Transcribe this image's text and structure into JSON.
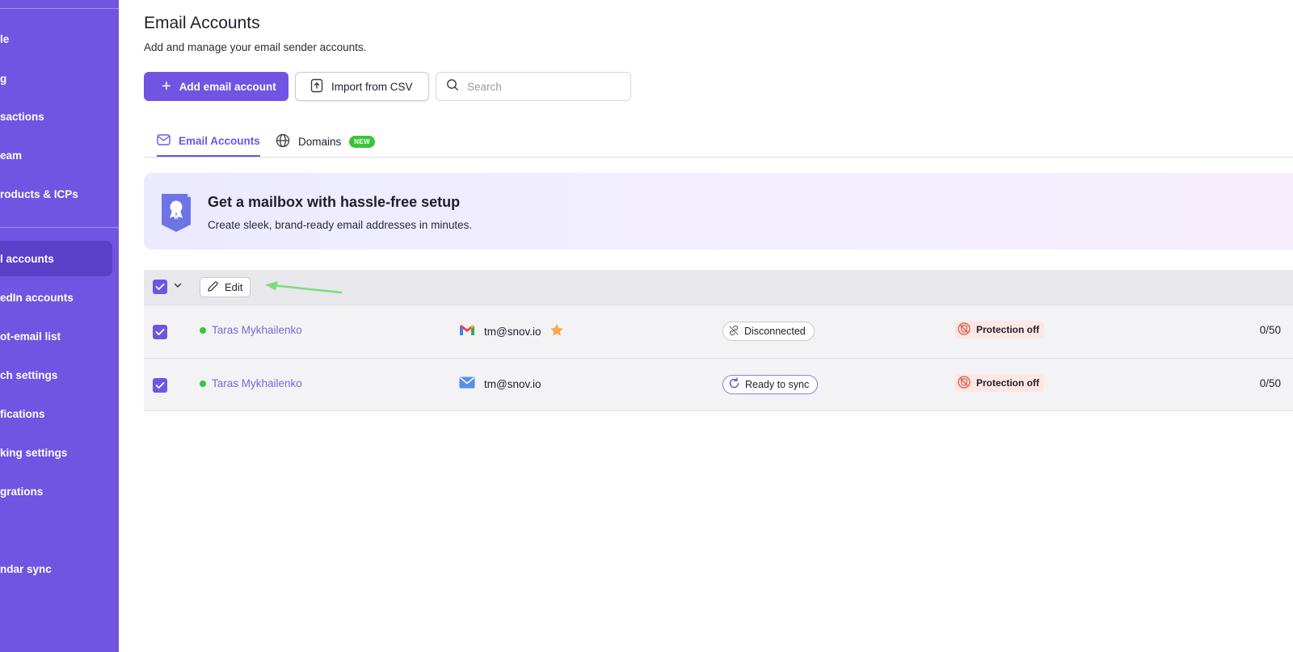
{
  "sidebar": {
    "items": [
      {
        "label": "le",
        "active": false
      },
      {
        "label": "g",
        "active": false
      },
      {
        "label": "sactions",
        "active": false
      },
      {
        "label": "eam",
        "active": false
      },
      {
        "label": "roducts & ICPs",
        "active": false
      },
      {
        "label": "l accounts",
        "active": true
      },
      {
        "label": "edIn accounts",
        "active": false
      },
      {
        "label": "ot-email list",
        "active": false
      },
      {
        "label": "ch settings",
        "active": false
      },
      {
        "label": "fications",
        "active": false
      },
      {
        "label": "king settings",
        "active": false
      },
      {
        "label": "grations",
        "active": false
      },
      {
        "label": "ndar sync",
        "active": false
      }
    ],
    "color": "#6f55e1"
  },
  "header": {
    "title": "Email Accounts",
    "subtitle": "Add and manage your email sender accounts."
  },
  "toolbar": {
    "add_label": "Add email account",
    "import_label": "Import from CSV",
    "search_placeholder": "Search"
  },
  "tabs": [
    {
      "label": "Email Accounts",
      "icon": "envelope-icon",
      "active": true
    },
    {
      "label": "Domains",
      "icon": "globe-icon",
      "badge": "NEW",
      "active": false
    }
  ],
  "banner": {
    "title": "Get a mailbox with hassle-free setup",
    "subtitle": "Create sleek, brand-ready email addresses in minutes."
  },
  "table": {
    "edit_label": "Edit",
    "rows": [
      {
        "name": "Taras Mykhailenko",
        "email": "tm@snov.io",
        "provider": "gmail-icon",
        "starred": true,
        "status": "Disconnected",
        "protection": "Protection off",
        "count": "0/50",
        "checked": true
      },
      {
        "name": "Taras Mykhailenko",
        "email": "tm@snov.io",
        "provider": "mail-icon",
        "starred": false,
        "status": "Ready to sync",
        "protection": "Protection off",
        "count": "0/50",
        "checked": true
      }
    ]
  },
  "colors": {
    "accent": "#6f55e1",
    "online": "#3bc43b",
    "protection_bg": "#fde7e4",
    "star": "#f5a94a"
  }
}
